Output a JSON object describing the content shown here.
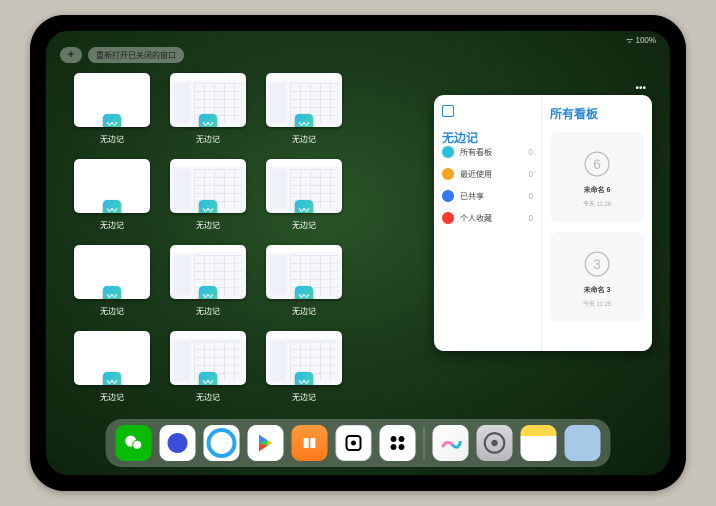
{
  "status": {
    "battery": "100%"
  },
  "topbar": {
    "plus": "+",
    "reopen_label": "重新打开已关闭的窗口"
  },
  "app_name": "无边记",
  "windows": [
    {
      "variant": "blank",
      "label": "无边记"
    },
    {
      "variant": "content",
      "label": "无边记"
    },
    {
      "variant": "content",
      "label": "无边记"
    },
    {
      "variant": "blank",
      "label": "无边记"
    },
    {
      "variant": "content",
      "label": "无边记"
    },
    {
      "variant": "content",
      "label": "无边记"
    },
    {
      "variant": "blank",
      "label": "无边记"
    },
    {
      "variant": "content",
      "label": "无边记"
    },
    {
      "variant": "content",
      "label": "无边记"
    },
    {
      "variant": "blank",
      "label": "无边记"
    },
    {
      "variant": "content",
      "label": "无边记"
    },
    {
      "variant": "content",
      "label": "无边记"
    }
  ],
  "panel": {
    "left_title": "无边记",
    "items": [
      {
        "label": "所有看板",
        "count": "0",
        "color": "ic-a"
      },
      {
        "label": "最近使用",
        "count": "0",
        "color": "ic-b"
      },
      {
        "label": "已共享",
        "count": "0",
        "color": "ic-c"
      },
      {
        "label": "个人收藏",
        "count": "0",
        "color": "ic-d"
      }
    ],
    "right_title": "所有看板",
    "boards": [
      {
        "name": "未命名 6",
        "sub": "今天 11:26",
        "num": "6"
      },
      {
        "name": "未命名 3",
        "sub": "今天 11:25",
        "num": "3"
      }
    ]
  },
  "dock": {
    "apps": [
      {
        "name": "wechat"
      },
      {
        "name": "quark"
      },
      {
        "name": "qqbrowser"
      },
      {
        "name": "play"
      },
      {
        "name": "books"
      },
      {
        "name": "dice"
      },
      {
        "name": "circles"
      }
    ],
    "recent": [
      {
        "name": "freeform"
      },
      {
        "name": "settings"
      },
      {
        "name": "notes"
      },
      {
        "name": "app-library"
      }
    ]
  }
}
